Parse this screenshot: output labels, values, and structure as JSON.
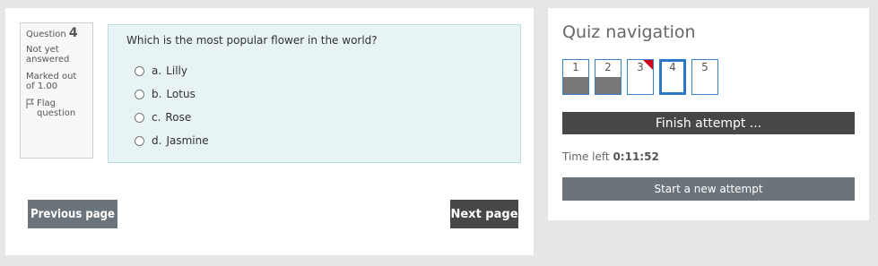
{
  "question_info": {
    "label": "Question",
    "number": "4",
    "status": "Not yet answered",
    "marked": "Marked out of 1.00",
    "flag_label": "Flag question",
    "flag_icon": "flag-icon"
  },
  "question": {
    "text": "Which is the most popular flower in the world?",
    "answers": [
      {
        "letter": "a.",
        "text": "Lilly"
      },
      {
        "letter": "b.",
        "text": "Lotus"
      },
      {
        "letter": "c.",
        "text": "Rose"
      },
      {
        "letter": "d.",
        "text": "Jasmine"
      }
    ]
  },
  "buttons": {
    "previous": "Previous page",
    "next": "Next page"
  },
  "quiz_nav": {
    "title": "Quiz navigation",
    "questions": [
      {
        "number": "1",
        "answered": true,
        "flagged": false,
        "current": false
      },
      {
        "number": "2",
        "answered": true,
        "flagged": false,
        "current": false
      },
      {
        "number": "3",
        "answered": false,
        "flagged": true,
        "current": false
      },
      {
        "number": "4",
        "answered": false,
        "flagged": false,
        "current": true
      },
      {
        "number": "5",
        "answered": false,
        "flagged": false,
        "current": false
      }
    ],
    "finish_label": "Finish attempt ...",
    "time_left_label": "Time left",
    "time_left_value": "0:11:52",
    "start_new_label": "Start a new attempt"
  },
  "colors": {
    "accent_blue": "#2b77c9",
    "flag_red": "#d0021b",
    "dark_button": "#474747",
    "grey_button": "#6b747b",
    "content_bg": "#e7f3f5"
  }
}
